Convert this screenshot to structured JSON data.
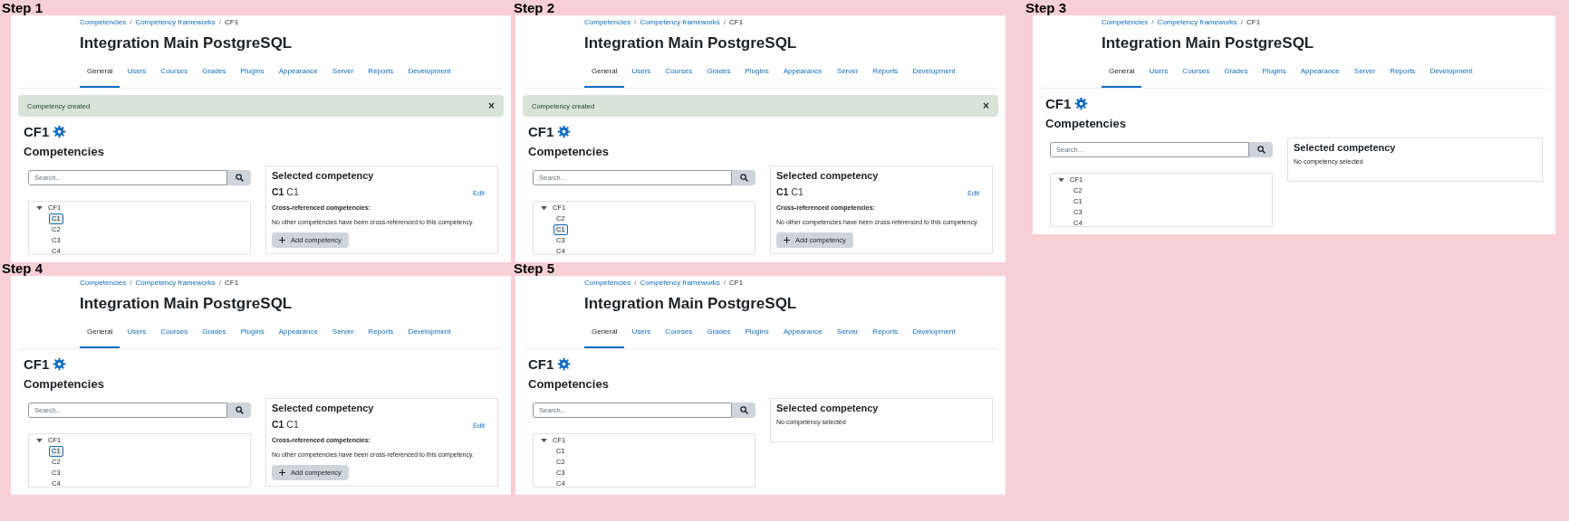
{
  "steps": [
    {
      "label": "Step 1",
      "breadcrumb": [
        {
          "kind": "link",
          "text": "Competencies"
        },
        {
          "kind": "separator",
          "text": "/"
        },
        {
          "kind": "link",
          "text": "Competency frameworks"
        },
        {
          "kind": "separator",
          "text": "/"
        },
        {
          "kind": "current",
          "text": "CF1"
        }
      ],
      "site_title": "Integration Main PostgreSQL",
      "tabs": [
        {
          "label": "General",
          "selected": true
        },
        {
          "label": "Users",
          "selected": false
        },
        {
          "label": "Courses",
          "selected": false
        },
        {
          "label": "Grades",
          "selected": false
        },
        {
          "label": "Plugins",
          "selected": false
        },
        {
          "label": "Appearance",
          "selected": false
        },
        {
          "label": "Server",
          "selected": false
        },
        {
          "label": "Reports",
          "selected": false
        },
        {
          "label": "Development",
          "selected": false
        }
      ],
      "alert": {
        "text": "Competency created",
        "close": "×"
      },
      "framework": "CF1",
      "section": "Competencies",
      "search_placeholder": "Search...",
      "tree": [
        {
          "label": "CF1",
          "expanded": true,
          "selected": false,
          "children": [
            {
              "label": "C1",
              "selected": true
            },
            {
              "label": "C2",
              "selected": false
            },
            {
              "label": "C3",
              "selected": false
            },
            {
              "label": "C4",
              "selected": false
            }
          ]
        }
      ],
      "detail": {
        "kind": "competency",
        "title": "Selected competency",
        "idnumber": "C1",
        "shortname": "C1",
        "edit": "Edit",
        "cross_heading": "Cross-referenced competencies:",
        "cross_text": "No other competencies have been cross-referenced to this competency.",
        "add_button": "Add competency"
      }
    },
    {
      "label": "Step 2",
      "breadcrumb": [
        {
          "kind": "link",
          "text": "Competencies"
        },
        {
          "kind": "separator",
          "text": "/"
        },
        {
          "kind": "link",
          "text": "Competency frameworks"
        },
        {
          "kind": "separator",
          "text": "/"
        },
        {
          "kind": "current",
          "text": "CF1"
        }
      ],
      "site_title": "Integration Main PostgreSQL",
      "tabs": [
        {
          "label": "General",
          "selected": true
        },
        {
          "label": "Users",
          "selected": false
        },
        {
          "label": "Courses",
          "selected": false
        },
        {
          "label": "Grades",
          "selected": false
        },
        {
          "label": "Plugins",
          "selected": false
        },
        {
          "label": "Appearance",
          "selected": false
        },
        {
          "label": "Server",
          "selected": false
        },
        {
          "label": "Reports",
          "selected": false
        },
        {
          "label": "Development",
          "selected": false
        }
      ],
      "alert": {
        "text": "Competency created",
        "close": "×"
      },
      "framework": "CF1",
      "section": "Competencies",
      "search_placeholder": "Search...",
      "tree": [
        {
          "label": "CF1",
          "expanded": true,
          "selected": false,
          "children": [
            {
              "label": "C2",
              "selected": false
            },
            {
              "label": "C1",
              "selected": true
            },
            {
              "label": "C3",
              "selected": false
            },
            {
              "label": "C4",
              "selected": false
            }
          ]
        }
      ],
      "detail": {
        "kind": "competency",
        "title": "Selected competency",
        "idnumber": "C1",
        "shortname": "C1",
        "edit": "Edit",
        "cross_heading": "Cross-referenced competencies:",
        "cross_text": "No other competencies have been cross-referenced to this competency.",
        "add_button": "Add competency"
      }
    },
    {
      "label": "Step 3",
      "breadcrumb": [
        {
          "kind": "link",
          "text": "Competencies"
        },
        {
          "kind": "separator",
          "text": "/"
        },
        {
          "kind": "link",
          "text": "Competency frameworks"
        },
        {
          "kind": "separator",
          "text": "/"
        },
        {
          "kind": "current",
          "text": "CF1"
        }
      ],
      "site_title": "Integration Main PostgreSQL",
      "tabs": [
        {
          "label": "General",
          "selected": true
        },
        {
          "label": "Users",
          "selected": false
        },
        {
          "label": "Courses",
          "selected": false
        },
        {
          "label": "Grades",
          "selected": false
        },
        {
          "label": "Plugins",
          "selected": false
        },
        {
          "label": "Appearance",
          "selected": false
        },
        {
          "label": "Server",
          "selected": false
        },
        {
          "label": "Reports",
          "selected": false
        },
        {
          "label": "Development",
          "selected": false
        }
      ],
      "framework": "CF1",
      "section": "Competencies",
      "search_placeholder": "Search...",
      "tree": [
        {
          "label": "CF1",
          "expanded": true,
          "selected": false,
          "children": [
            {
              "label": "C2",
              "selected": false
            },
            {
              "label": "C1",
              "selected": false
            },
            {
              "label": "C3",
              "selected": false
            },
            {
              "label": "C4",
              "selected": false
            }
          ]
        }
      ],
      "detail": {
        "kind": "empty",
        "title": "Selected competency",
        "message": "No competency selected"
      }
    },
    {
      "label": "Step 4",
      "breadcrumb": [
        {
          "kind": "link",
          "text": "Competencies"
        },
        {
          "kind": "separator",
          "text": "/"
        },
        {
          "kind": "link",
          "text": "Competency frameworks"
        },
        {
          "kind": "separator",
          "text": "/"
        },
        {
          "kind": "current",
          "text": "CF1"
        }
      ],
      "site_title": "Integration Main PostgreSQL",
      "tabs": [
        {
          "label": "General",
          "selected": true
        },
        {
          "label": "Users",
          "selected": false
        },
        {
          "label": "Courses",
          "selected": false
        },
        {
          "label": "Grades",
          "selected": false
        },
        {
          "label": "Plugins",
          "selected": false
        },
        {
          "label": "Appearance",
          "selected": false
        },
        {
          "label": "Server",
          "selected": false
        },
        {
          "label": "Reports",
          "selected": false
        },
        {
          "label": "Development",
          "selected": false
        }
      ],
      "framework": "CF1",
      "section": "Competencies",
      "search_placeholder": "Search...",
      "tree": [
        {
          "label": "CF1",
          "expanded": true,
          "selected": false,
          "children": [
            {
              "label": "C1",
              "selected": true
            },
            {
              "label": "C2",
              "selected": false
            },
            {
              "label": "C3",
              "selected": false
            },
            {
              "label": "C4",
              "selected": false
            }
          ]
        }
      ],
      "detail": {
        "kind": "competency",
        "title": "Selected competency",
        "idnumber": "C1",
        "shortname": "C1",
        "edit": "Edit",
        "cross_heading": "Cross-referenced competencies:",
        "cross_text": "No other competencies have been cross-referenced to this competency.",
        "add_button": "Add competency"
      }
    },
    {
      "label": "Step 5",
      "breadcrumb": [
        {
          "kind": "link",
          "text": "Competencies"
        },
        {
          "kind": "separator",
          "text": "/"
        },
        {
          "kind": "link",
          "text": "Competency frameworks"
        },
        {
          "kind": "separator",
          "text": "/"
        },
        {
          "kind": "current",
          "text": "CF1"
        }
      ],
      "site_title": "Integration Main PostgreSQL",
      "tabs": [
        {
          "label": "General",
          "selected": true
        },
        {
          "label": "Users",
          "selected": false
        },
        {
          "label": "Courses",
          "selected": false
        },
        {
          "label": "Grades",
          "selected": false
        },
        {
          "label": "Plugins",
          "selected": false
        },
        {
          "label": "Appearance",
          "selected": false
        },
        {
          "label": "Server",
          "selected": false
        },
        {
          "label": "Reports",
          "selected": false
        },
        {
          "label": "Development",
          "selected": false
        }
      ],
      "framework": "CF1",
      "section": "Competencies",
      "search_placeholder": "Search...",
      "tree": [
        {
          "label": "CF1",
          "expanded": true,
          "selected": false,
          "children": [
            {
              "label": "C1",
              "selected": false
            },
            {
              "label": "C2",
              "selected": false
            },
            {
              "label": "C3",
              "selected": false
            },
            {
              "label": "C4",
              "selected": false
            }
          ]
        }
      ],
      "detail": {
        "kind": "empty",
        "title": "Selected competency",
        "message": "No competency selected"
      }
    }
  ]
}
